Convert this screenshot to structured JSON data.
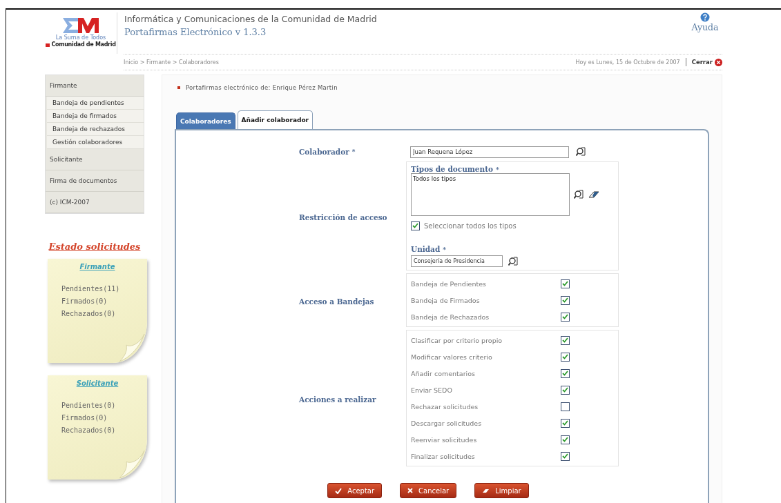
{
  "header": {
    "logo_tagline": "La Suma de Todos",
    "logo_org": "Comunidad de Madrid",
    "org": "Informática y Comunicaciones de la Comunidad de Madrid",
    "app": "Portafirmas Electrónico v 1.3.3",
    "help": "Ayuda",
    "breadcrumb": "Inicio > Firmante > Colaboradores",
    "date": "Hoy es Lunes, 15 de Octubre de 2007",
    "close": "Cerrar"
  },
  "sidebar": {
    "sections": [
      {
        "label": "Firmante",
        "children": [
          {
            "label": "Bandeja de pendientes"
          },
          {
            "label": "Bandeja de firmados"
          },
          {
            "label": "Bandeja de rechazados"
          },
          {
            "label": "Gestión colaboradores"
          }
        ]
      },
      {
        "label": "Solicitante"
      },
      {
        "label": "Firma de documentos"
      },
      {
        "label": "(c) ICM-2007"
      }
    ]
  },
  "status": {
    "title": "Estado solicitudes",
    "notes": [
      {
        "title": "Firmante",
        "items": [
          "Pendientes(11)",
          "Firmados(0)",
          "Rechazados(0)"
        ]
      },
      {
        "title": "Solicitante",
        "items": [
          "Pendientes(0)",
          "Firmados(0)",
          "Rechazados(0)"
        ]
      }
    ]
  },
  "owner": "Portafirmas electrónico de: Enrique Pérez Martin",
  "tabs": [
    {
      "label": "Colaboradores",
      "selected": false
    },
    {
      "label": "Añadir colaborador",
      "selected": true
    }
  ],
  "form": {
    "colaborador": {
      "label": "Colaborador",
      "required": "*",
      "value": "Juan Requena López"
    },
    "restriccion": {
      "label": "Restricción de acceso",
      "types_label": "Tipos de documento",
      "types_required": "*",
      "types_value": "Todos los tipos",
      "select_all": {
        "label": "Seleccionar todos los tipos",
        "checked": true
      },
      "unit_label": "Unidad",
      "unit_required": "*",
      "unit_value": "Consejería de Presidencia"
    },
    "bandejas": {
      "label": "Acceso a Bandejas",
      "items": [
        {
          "label": "Bandeja de Pendientes",
          "checked": true
        },
        {
          "label": "Bandeja de Firmados",
          "checked": true
        },
        {
          "label": "Bandeja de Rechazados",
          "checked": true
        }
      ]
    },
    "acciones": {
      "label": "Acciones a realizar",
      "items": [
        {
          "label": "Clasificar por criterio propio",
          "checked": true
        },
        {
          "label": "Modificar valores criterio",
          "checked": true
        },
        {
          "label": "Añadir comentarios",
          "checked": true
        },
        {
          "label": "Enviar SEDO",
          "checked": true
        },
        {
          "label": "Rechazar solicitudes",
          "checked": false
        },
        {
          "label": "Descargar solicitudes",
          "checked": true
        },
        {
          "label": "Reenviar solicitudes",
          "checked": true
        },
        {
          "label": "Finalizar solicitudes",
          "checked": true
        }
      ]
    }
  },
  "buttons": [
    {
      "label": "Aceptar",
      "kind": "accept"
    },
    {
      "label": "Cancelar",
      "kind": "cancel"
    },
    {
      "label": "Limpiar",
      "kind": "clear"
    }
  ]
}
